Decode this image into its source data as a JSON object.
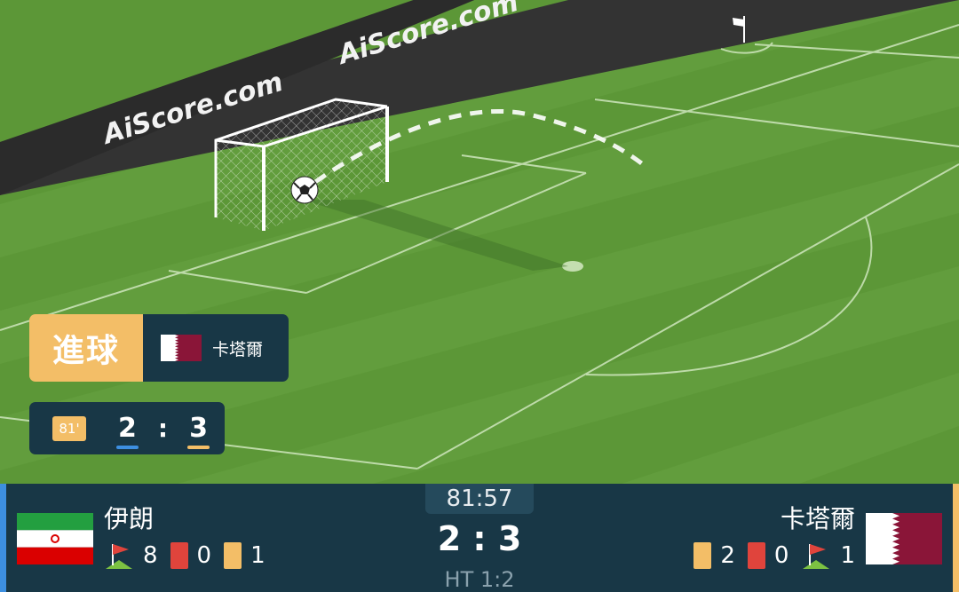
{
  "pitch": {
    "banner_text": [
      "AiScore.com",
      "AiScore.com"
    ]
  },
  "event": {
    "type": "進球",
    "team": "卡塔爾"
  },
  "mini_score": {
    "minute": "81'",
    "home": "2",
    "sep": ":",
    "away": "3"
  },
  "match": {
    "clock": "81:57",
    "score": "2 : 3",
    "half_time": "HT 1:2",
    "home": {
      "name": "伊朗",
      "corners": "8",
      "red_cards": "0",
      "yellow_cards": "1"
    },
    "away": {
      "name": "卡塔爾",
      "yellow_cards": "2",
      "red_cards": "0",
      "corners": "1"
    }
  },
  "colors": {
    "home_accent": "#3d8fe0",
    "away_accent": "#f3be67",
    "panel": "#183746"
  }
}
